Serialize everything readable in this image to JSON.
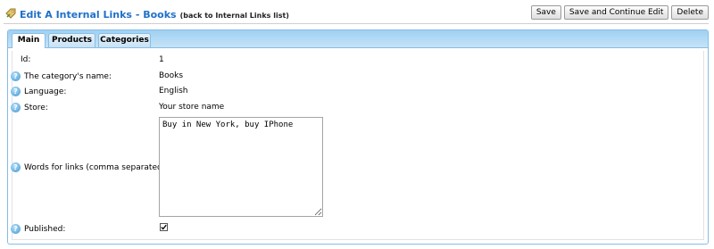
{
  "header": {
    "title": "Edit A Internal Links - Books",
    "back_link": "(back to Internal Links list)",
    "buttons": {
      "save": "Save",
      "save_continue": "Save and Continue Edit",
      "delete": "Delete"
    }
  },
  "tabs": [
    {
      "label": "Main",
      "active": true
    },
    {
      "label": "Products",
      "active": false
    },
    {
      "label": "Categories",
      "active": false
    }
  ],
  "form": {
    "id": {
      "label": "Id:",
      "value": "1"
    },
    "category_name": {
      "label": "The category's name:",
      "value": "Books"
    },
    "language": {
      "label": "Language:",
      "value": "English"
    },
    "store": {
      "label": "Store:",
      "value": "Your store name"
    },
    "words": {
      "label": "Words for links (comma separated):",
      "value": "Buy in New York, buy IPhone"
    },
    "published": {
      "label": "Published:",
      "checked": true
    }
  },
  "icons": {
    "title": "tag-icon",
    "info": "info-icon",
    "check": "checkmark-icon"
  },
  "colors": {
    "title": "#1f70c8",
    "tab_border": "#86bde6",
    "tab_bar": "#b4daf4",
    "info_icon": "#3d97d6"
  }
}
